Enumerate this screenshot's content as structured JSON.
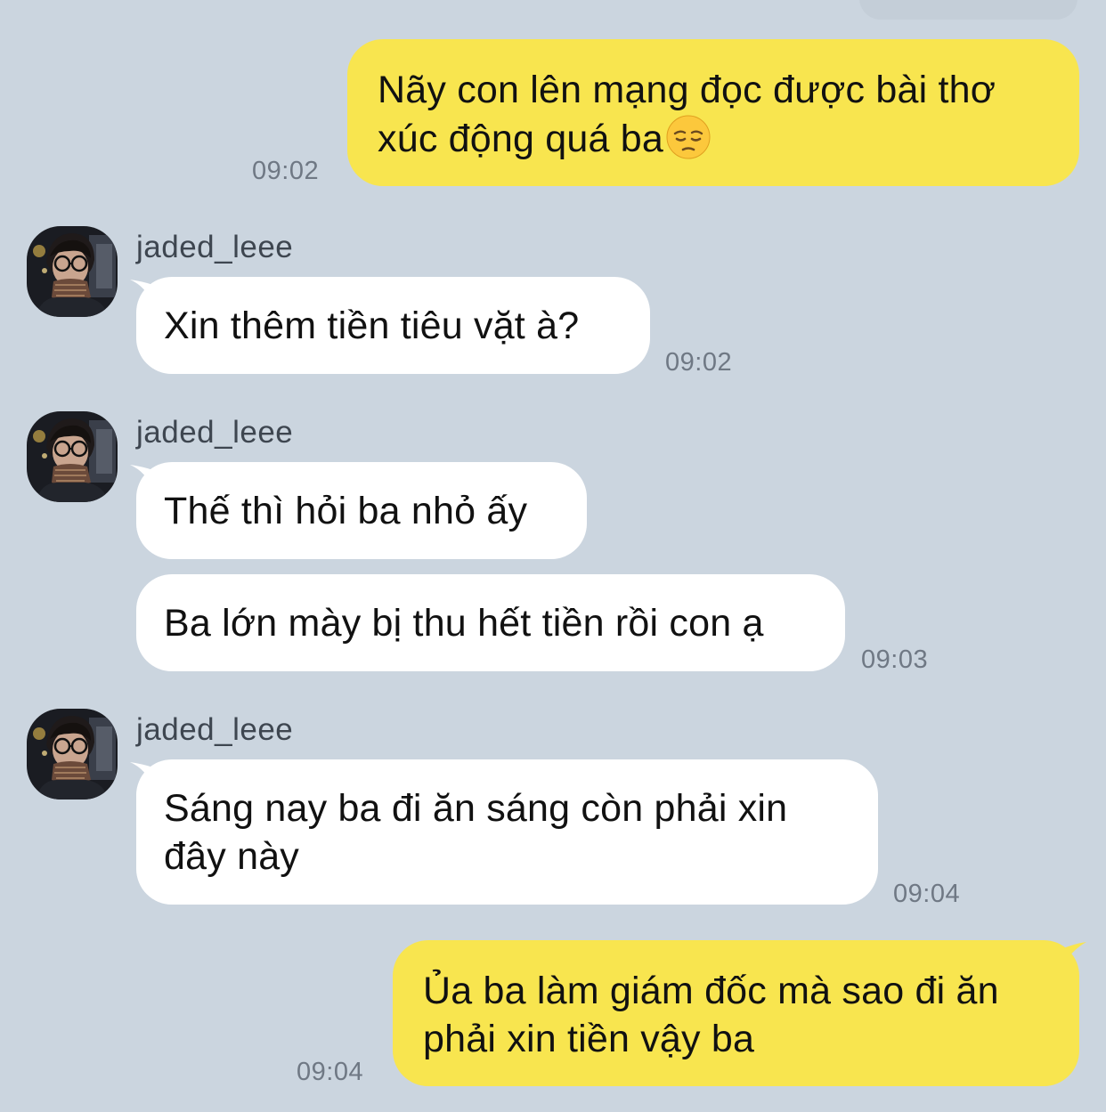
{
  "messages": [
    {
      "text": "Nãy con lên mạng đọc được bài thơ xúc động quá ba",
      "emoji": "pensive-face",
      "time": "09:02"
    },
    {
      "sender": "jaded_leee",
      "text": "Xin thêm tiền tiêu vặt à?",
      "time": "09:02"
    },
    {
      "sender": "jaded_leee",
      "text": "Thế thì hỏi ba nhỏ ấy"
    },
    {
      "text": "Ba lớn mày bị thu hết tiền rồi con ạ",
      "time": "09:03"
    },
    {
      "sender": "jaded_leee",
      "text": "Sáng nay ba đi ăn sáng còn phải xin đây này",
      "time": "09:04"
    },
    {
      "text": "Ủa ba làm giám đốc mà sao đi ăn phải xin tiền vậy ba",
      "time": "09:04"
    }
  ],
  "colors": {
    "background": "#cbd5df",
    "outgoing_bubble": "#f8e54f",
    "incoming_bubble": "#ffffff",
    "timestamp": "#6f7884"
  }
}
